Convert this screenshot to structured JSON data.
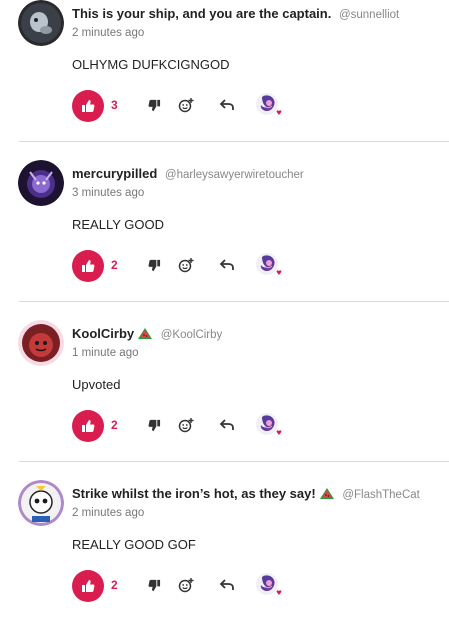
{
  "comments": [
    {
      "author": "This is your ship, and you are the captain.",
      "handle": "@sunnelliot",
      "timestamp": "2 minutes ago",
      "text": "OLHYMG DUFKCIGNGOD",
      "upvotes": "3",
      "has_melon": false,
      "avatar_color": "#2a2a2e"
    },
    {
      "author": "mercurypilled",
      "handle": "@harleysawyerwiretoucher",
      "timestamp": "3 minutes ago",
      "text": "REALLY GOOD",
      "upvotes": "2",
      "has_melon": false,
      "avatar_color": "#3a2a5c"
    },
    {
      "author": "KoolCirby",
      "handle": "@KoolCirby",
      "timestamp": "1 minute ago",
      "text": "Upvoted",
      "upvotes": "2",
      "has_melon": true,
      "avatar_color": "#7a2a2a"
    },
    {
      "author": "Strike whilst the iron’s hot, as they say!",
      "handle": "@FlashTheCat",
      "timestamp": "2 minutes ago",
      "text": "REALLY GOOD GOF",
      "upvotes": "2",
      "has_melon": true,
      "avatar_color": "#b089c9"
    }
  ],
  "colors": {
    "accent": "#d91d4f",
    "divider": "#d8d8d8"
  },
  "icons": [
    "thumbs-up-icon",
    "thumbs-down-icon",
    "add-reaction-icon",
    "reply-icon",
    "reaction-sticker-icon",
    "watermelon-icon"
  ]
}
